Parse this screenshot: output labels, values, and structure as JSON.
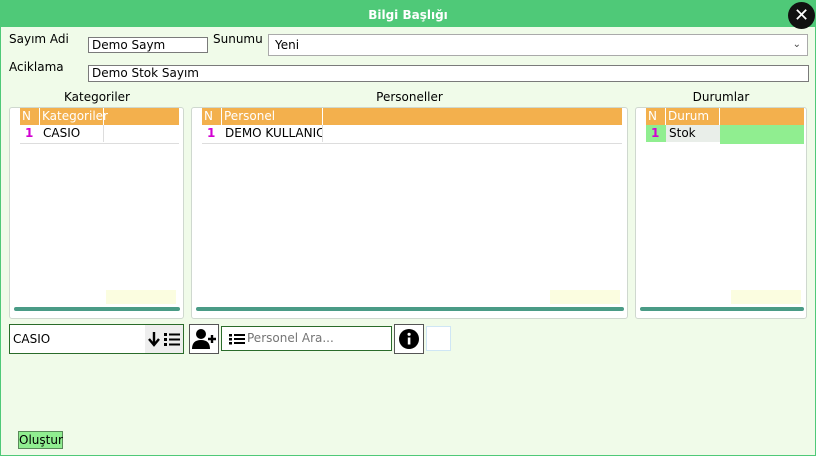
{
  "title": "Bilgi Başlığı",
  "form": {
    "sayim_adi_label": "Sayım Adi",
    "sayim_adi_value": "Demo Saym",
    "sunumu_label": "Sunumu",
    "sunumu_value": "Yeni",
    "aciklama_label": "Aciklama",
    "aciklama_value": "Demo Stok Sayım"
  },
  "kategoriler": {
    "title": "Kategoriler",
    "headers": [
      "N",
      "Kategoriler"
    ],
    "rows": [
      {
        "n": "1",
        "name": "CASIO"
      }
    ]
  },
  "personeller": {
    "title": "Personeller",
    "headers": [
      "N",
      "Personel"
    ],
    "rows": [
      {
        "n": "1",
        "name": "DEMO KULLANICI"
      }
    ]
  },
  "durumlar": {
    "title": "Durumlar",
    "headers": [
      "N",
      "Durum"
    ],
    "rows": [
      {
        "n": "1",
        "name": "Stok"
      }
    ],
    "status_color": "#90ee90"
  },
  "controls": {
    "category_value": "CASIO",
    "personel_placeholder": "Personel Ara..."
  },
  "actions": {
    "create_label": "Oluştur"
  },
  "colors": {
    "accent": "#4fc978",
    "grid_header": "#f3b04d",
    "row_number": "#d200d2"
  }
}
